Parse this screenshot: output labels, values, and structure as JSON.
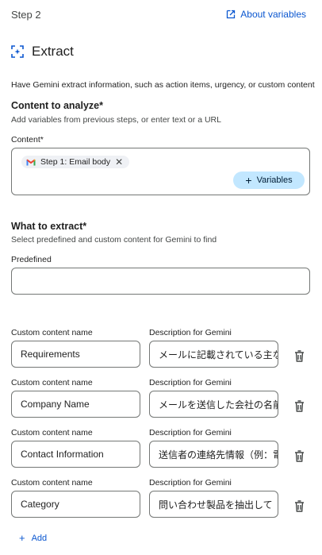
{
  "header": {
    "step": "Step 2",
    "about_link": "About variables"
  },
  "title": "Extract",
  "description": "Have Gemini extract information, such as action items, urgency, or custom content",
  "content_section": {
    "title": "Content to analyze*",
    "subtitle": "Add variables from previous steps, or enter text or a URL",
    "field_label": "Content*",
    "chip_label": "Step 1: Email body",
    "variables_button": "Variables"
  },
  "extract_section": {
    "title": "What to extract*",
    "subtitle": "Select predefined and custom content for Gemini to find",
    "predefined_label": "Predefined",
    "predefined_value": ""
  },
  "custom_rows": [
    {
      "name_label": "Custom content name",
      "desc_label": "Description for Gemini",
      "name": "Requirements",
      "description": "メールに記載されている主な要件"
    },
    {
      "name_label": "Custom content name",
      "desc_label": "Description for Gemini",
      "name": "Company Name",
      "description": "メールを送信した会社の名前"
    },
    {
      "name_label": "Custom content name",
      "desc_label": "Description for Gemini",
      "name": "Contact Information",
      "description": "送信者の連絡先情報（例：電話番号"
    },
    {
      "name_label": "Custom content name",
      "desc_label": "Description for Gemini",
      "name": "Category",
      "description": "問い合わせ製品を抽出して"
    }
  ],
  "add_button": "Add"
}
